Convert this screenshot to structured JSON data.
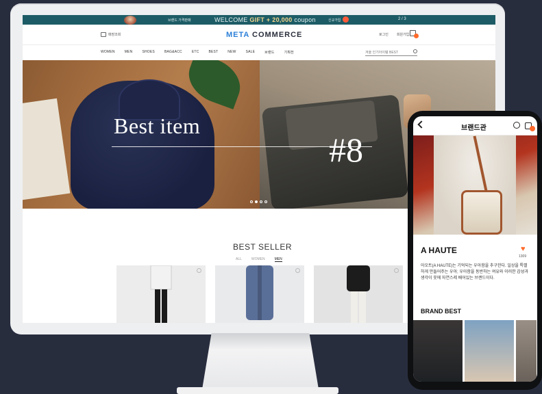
{
  "desktop": {
    "promo": {
      "brand_small": "브랜드 가격판매",
      "welcome_prefix": "WELCOME ",
      "gift": "GIFT + 20,000",
      "welcome_suffix": " coupon",
      "signup": "신규가입",
      "pager": "2 / 3"
    },
    "header": {
      "store_label": "매장조회",
      "logo_meta": "META",
      "logo_commerce": " COMMERCE",
      "login": "로그인",
      "join": "회원가입"
    },
    "gnb": {
      "items": [
        "WOMEN",
        "MEN",
        "SHOES",
        "BAG&ACC",
        "ETC",
        "BEST",
        "NEW",
        "SALE",
        "브랜드",
        "기획전"
      ],
      "search_placeholder": "겨울 인기아이템 BEST"
    },
    "hero": {
      "title": "Best item",
      "number": "#8",
      "dots": 4,
      "active_dot": 2
    },
    "best_seller": {
      "title": "BEST SELLER",
      "tabs": [
        "ALL",
        "WOMEN",
        "MEN"
      ],
      "active_tab": "MEN"
    }
  },
  "mobile": {
    "header_title": "브랜드관",
    "brand_name": "A HAUTE",
    "like_count": "1309",
    "description": "아오트(A HAUTE)는 기억되는 우아함을 추구한다. 일상을 특별하게 만들어주는 우아; 우아함을 동반하는 여유와 이러한 감성과 생각이 옷에 자연스레 배어있는 브랜드이다.",
    "section_title": "BRAND BEST"
  },
  "colors": {
    "promo_bg": "#1d5c66",
    "accent_orange": "#ff6a2b",
    "logo_blue": "#2b7fd8",
    "background": "#282d3e"
  }
}
